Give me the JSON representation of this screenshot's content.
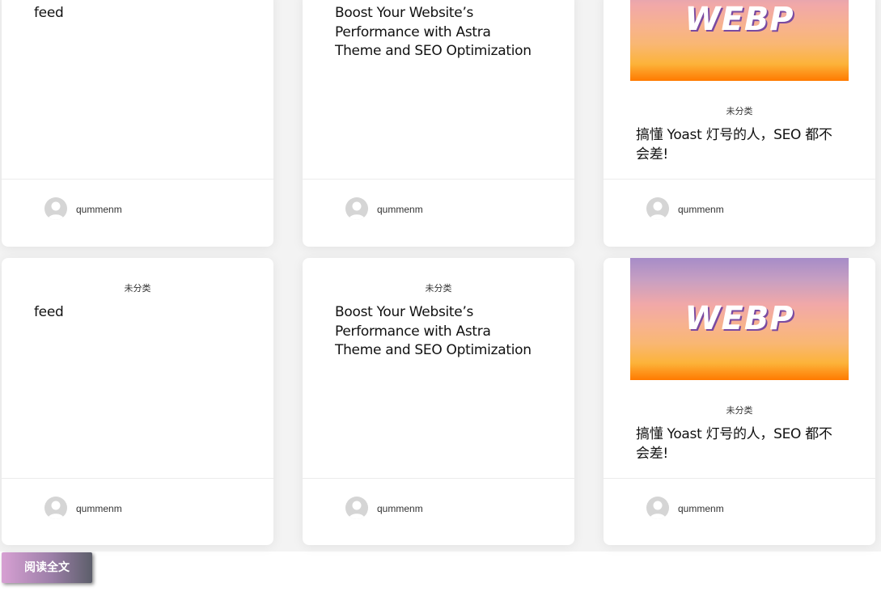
{
  "cards": [
    {
      "category": "",
      "title": "feed",
      "author": "qummenm"
    },
    {
      "category": "",
      "title": "Boost Your Website’s Performance with Astra Theme and SEO Optimization",
      "author": "qummenm"
    },
    {
      "category": "未分类",
      "title": "搞懂 Yoast 灯号的人，SEO 都不会差!",
      "author": "qummenm",
      "thumb_text": "WEBP"
    },
    {
      "category": "未分类",
      "title": "feed",
      "author": "qummenm"
    },
    {
      "category": "未分类",
      "title": "Boost Your Website’s Performance with Astra Theme and SEO Optimization",
      "author": "qummenm"
    },
    {
      "category": "未分类",
      "title": "搞懂 Yoast 灯号的人，SEO 都不会差!",
      "author": "qummenm",
      "thumb_text": "WEBP"
    }
  ],
  "read_more_label": "阅读全文"
}
